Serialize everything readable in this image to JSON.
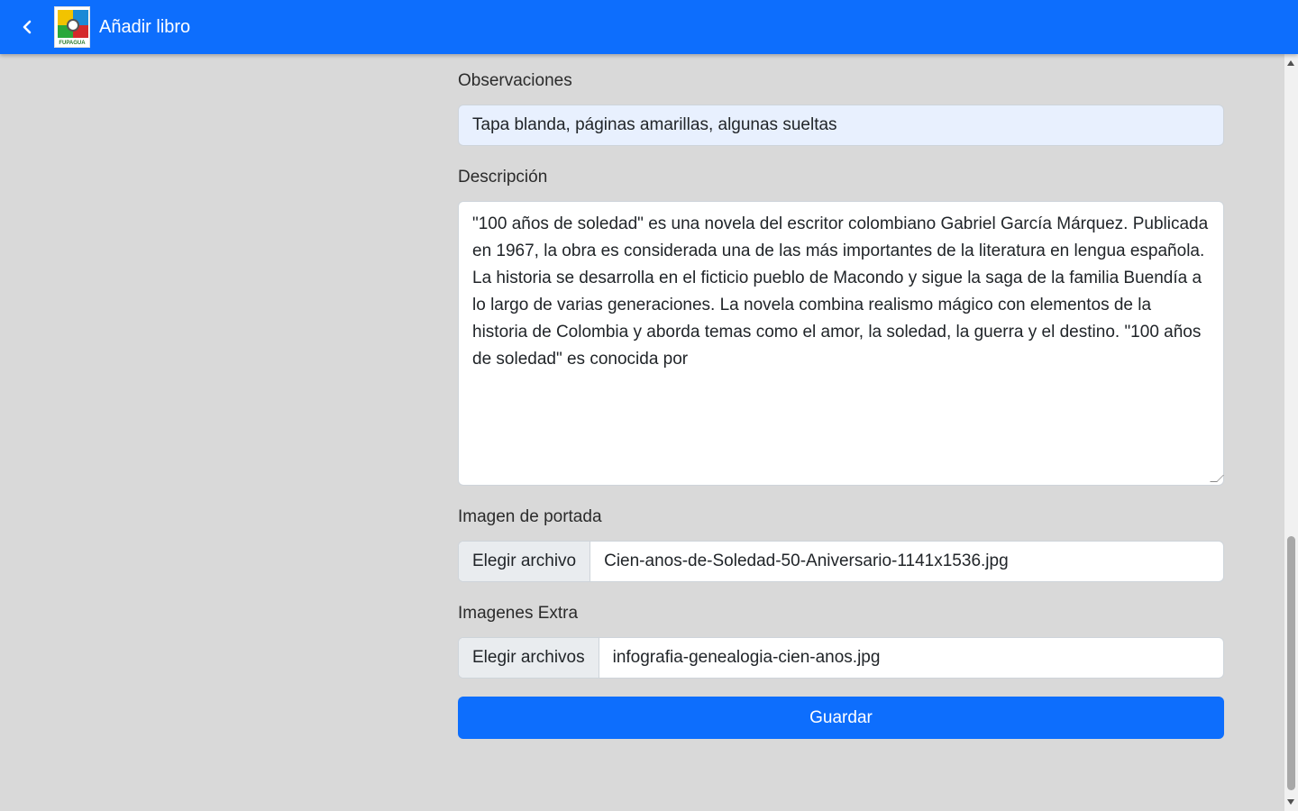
{
  "header": {
    "title": "Añadir libro",
    "logo_text": "FUPAGUA",
    "back_icon": "chevron-left-icon",
    "color": "#0d6efd"
  },
  "form": {
    "observaciones": {
      "label": "Observaciones",
      "value": "Tapa blanda, páginas amarillas, algunas sueltas"
    },
    "descripcion": {
      "label": "Descripción",
      "value": "\"100 años de soledad\" es una novela del escritor colombiano Gabriel García Márquez. Publicada en 1967, la obra es considerada una de las más importantes de la literatura en lengua española. La historia se desarrolla en el ficticio pueblo de Macondo y sigue la saga de la familia Buendía a lo largo de varias generaciones. La novela combina realismo mágico con elementos de la historia de Colombia y aborda temas como el amor, la soledad, la guerra y el destino. \"100 años de soledad\" es conocida por"
    },
    "portada": {
      "label": "Imagen de portada",
      "button": "Elegir archivo",
      "file": "Cien-anos-de-Soledad-50-Aniversario-1141x1536.jpg"
    },
    "extra": {
      "label": "Imagenes Extra",
      "button": "Elegir archivos",
      "file": "infografia-genealogia-cien-anos.jpg"
    },
    "save_label": "Guardar"
  }
}
